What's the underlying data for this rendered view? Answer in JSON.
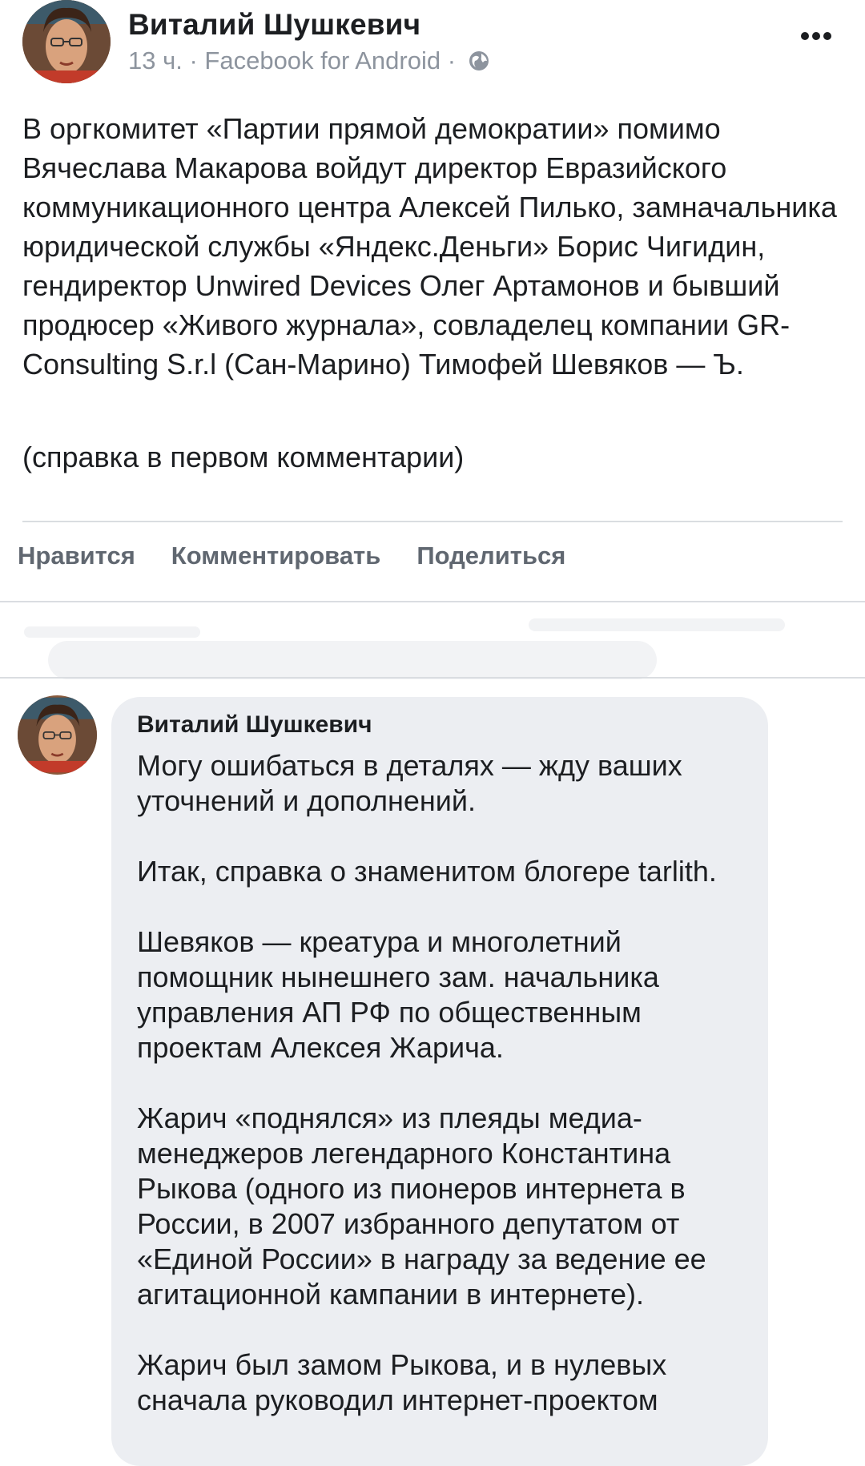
{
  "post": {
    "author_name": "Виталий Шушкевич",
    "meta": "13 ч. · Facebook for Android ·",
    "body": "В оргкомитет «Партии прямой демократии» помимо Вячеслава Макарова войдут директор Евразийского коммуникационного центра Алексей Пилько, замначальника юридической службы «Яндекс.Деньги» Борис Чигидин, гендиректор Unwired Devices Олег Артамонов и бывший продюсер «Живого журнала», совладелец компании GR-Consulting S.r.l (Сан-Марино) Тимофей Шевяков — Ъ.",
    "note": "(справка в первом комментарии)"
  },
  "actions": {
    "like": "Нравится",
    "comment": "Комментировать",
    "share": "Поделиться"
  },
  "comment": {
    "author_name": "Виталий Шушкевич",
    "paragraphs": [
      "Могу ошибаться в деталях — жду ваших уточнений и дополнений.",
      "Итак, справка о знаменитом блогере tarlith.",
      "Шевяков — креатура и многолетний помощник нынешнего зам. начальника управления АП РФ по общественным проектам Алексея Жарича.",
      "Жарич «поднялся» из плеяды медиа-менеджеров легендарного Константина Рыкова (одного из пионеров интернета в России, в 2007 избранного депутатом от «Единой России» в награду за ведение ее агитационной кампании в интернете).",
      "Жарич был замом Рыкова, и в нулевых сначала руководил интернет-проектом"
    ]
  },
  "icons": {
    "more": "more-dots-icon",
    "globe": "globe-icon"
  },
  "colors": {
    "text": "#1c1e21",
    "meta": "#8d949e",
    "action": "#606770",
    "bubble": "#eceef2",
    "divider": "#dadde1"
  }
}
